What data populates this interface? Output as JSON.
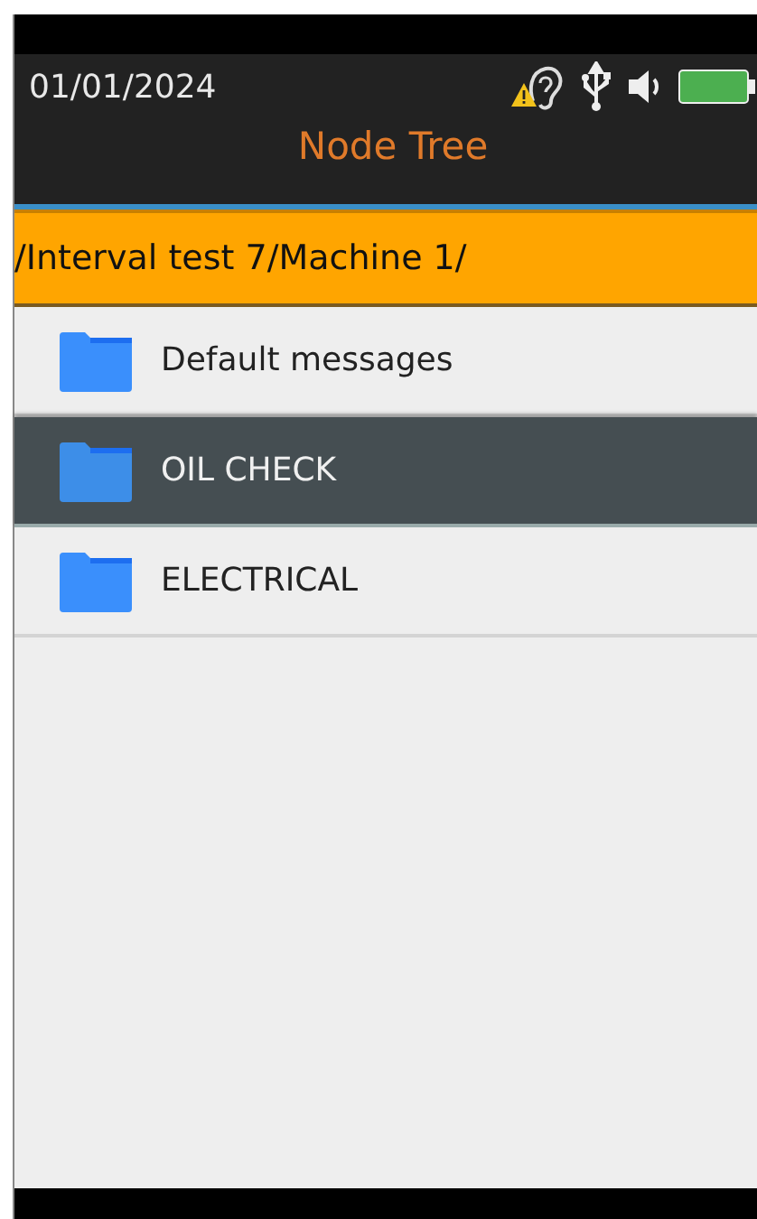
{
  "status_bar": {
    "date": "01/01/2024"
  },
  "header": {
    "title": "Node Tree"
  },
  "path_bar": {
    "path": "/Interval test 7/Machine 1/"
  },
  "nodes": [
    {
      "label": "Default messages",
      "selected": false
    },
    {
      "label": "OIL CHECK",
      "selected": true
    },
    {
      "label": "ELECTRICAL",
      "selected": false
    }
  ]
}
